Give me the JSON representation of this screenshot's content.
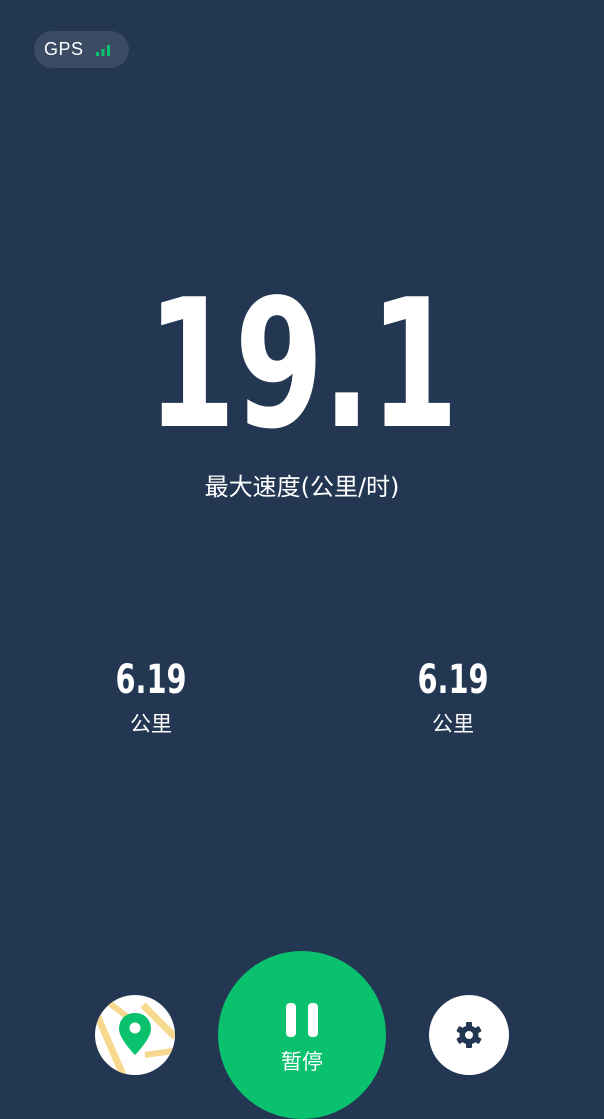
{
  "gps": {
    "label": "GPS",
    "signal_icon": "signal-bars-icon",
    "signal_color": "#0ac16e"
  },
  "speed": {
    "value": "19.1",
    "label": "最大速度(公里/时)"
  },
  "stats": [
    {
      "value": "6.19",
      "unit": "公里"
    },
    {
      "value": "6.19",
      "unit": "公里"
    }
  ],
  "controls": {
    "map_icon": "map-pin-icon",
    "pause_label": "暂停",
    "pause_icon": "pause-icon",
    "settings_icon": "gear-icon"
  },
  "colors": {
    "background": "#233752",
    "accent": "#0ac16e",
    "pill": "#3a4b63",
    "map_road": "#f6d98e"
  }
}
